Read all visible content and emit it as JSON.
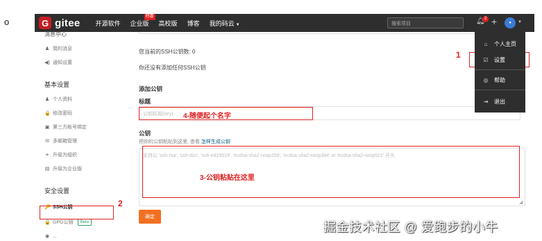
{
  "bullet": "o",
  "nav": {
    "logo_letter": "G",
    "logo_text": "gitee",
    "links": [
      "开源软件",
      "企业版",
      "高校版",
      "博客",
      "我的码云"
    ],
    "hot_badge": "特惠",
    "search_placeholder": "搜索项目",
    "notifications": "2",
    "plus": "+"
  },
  "sidebar": {
    "cut_top": "消息中心",
    "messages": [
      {
        "icon": "bell-icon",
        "glyph": "♟",
        "label": "我的消息"
      },
      {
        "icon": "speaker-icon",
        "glyph": "◀)",
        "label": "通知设置"
      }
    ],
    "basic_header": "基本设置",
    "basic_items": [
      {
        "icon": "user-icon",
        "glyph": "♟",
        "label": "个人资料"
      },
      {
        "icon": "lock-icon",
        "glyph": "🔒",
        "label": "修改密码"
      },
      {
        "icon": "account-icon",
        "glyph": "▣",
        "label": "第三方帐号绑定"
      },
      {
        "icon": "email-icon",
        "glyph": "✉",
        "label": "多邮箱管理"
      },
      {
        "icon": "org-icon",
        "glyph": "⚭",
        "label": "升级为组织"
      },
      {
        "icon": "enterprise-icon",
        "glyph": "▤",
        "label": "升级为企业版"
      }
    ],
    "security_header": "安全设置",
    "security_items": [
      {
        "icon": "key-icon",
        "glyph": "🔑",
        "label": "SSH公钥"
      },
      {
        "icon": "gpg-lock-icon",
        "glyph": "🔒",
        "label": "GPG公钥",
        "badge": "Beta"
      },
      {
        "icon": "shield-icon",
        "glyph": "◉",
        "label": "..."
      }
    ]
  },
  "main": {
    "ssh_count_label": "您当前的SSH公钥数: 0",
    "no_keys": "你还没有添加任何SSH公钥",
    "add_key_header": "添加公钥",
    "title_label": "标题",
    "title_placeholder": "公钥标题(key)",
    "key_label": "公钥",
    "key_hint": "把你的公钥粘贴到这里, 查看",
    "key_hint_link": "怎样生成公钥",
    "key_placeholder": "支持以 'ssh-rsa', 'ssh-dss', 'ssh-ed25519', 'ecdsa-sha2-nistp256', 'ecdsa-sha2-nistp384' or 'ecdsa-sha2-nistp521' 开头",
    "submit_label": "确定"
  },
  "dropdown": {
    "items": [
      {
        "icon": "home-icon",
        "glyph": "⌂",
        "label": "个人主页"
      },
      {
        "icon": "settings-icon",
        "glyph": "☑",
        "label": "设置"
      },
      {
        "icon": "help-icon",
        "glyph": "◎",
        "label": "帮助"
      },
      {
        "icon": "logout-icon",
        "glyph": "⇥",
        "label": "退出"
      }
    ]
  },
  "annotations": {
    "n1": "1",
    "n2": "2",
    "title_note": "4-随便起个名字",
    "key_note": "3-公钥粘贴在这里"
  },
  "watermark": "掘金技术社区 @ 爱跑步的小牛"
}
